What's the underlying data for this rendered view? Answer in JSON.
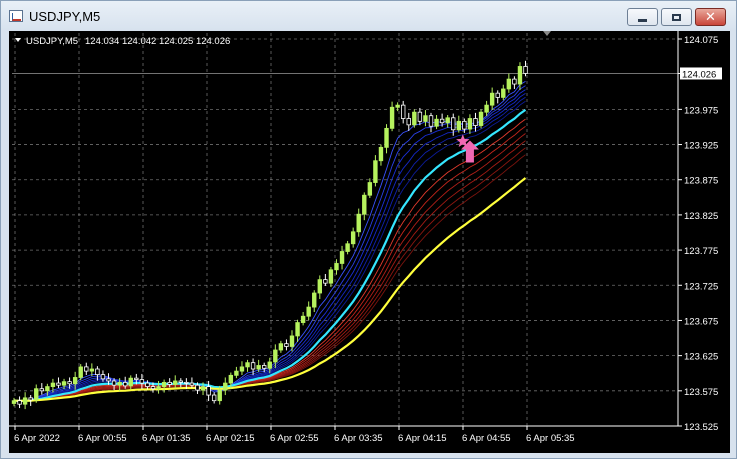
{
  "window": {
    "title": "USDJPY,M5",
    "minimize_label": "Minimize",
    "maximize_label": "Maximize",
    "close_label": "Close"
  },
  "chart_header": {
    "symbol": "USDJPY,M5",
    "ohlc": "124.034 124.042 124.025 124.026"
  },
  "colors": {
    "background": "#000000",
    "grid": "#c8c8c8",
    "bull_candle": "#b6f25e",
    "bear_candle": "#ffffff",
    "ema_fast_group": "#1a2fd6",
    "ema_cyan": "#35e6ff",
    "ema_slow_group": "#c4261c",
    "ema_yellow": "#ffff3c",
    "signal_marker": "#f068b4"
  },
  "chart_data": {
    "type": "candlestick",
    "symbol": "USDJPY",
    "timeframe": "M5",
    "current_price": "124.026",
    "y_ticks": [
      "124.075",
      "124.026",
      "123.975",
      "123.925",
      "123.875",
      "123.825",
      "123.775",
      "123.725",
      "123.675",
      "123.625",
      "123.575",
      "123.525"
    ],
    "y_tick_values": [
      124.075,
      124.026,
      123.975,
      123.925,
      123.875,
      123.825,
      123.775,
      123.725,
      123.675,
      123.625,
      123.575,
      123.525
    ],
    "ylim": [
      123.525,
      124.075
    ],
    "x_ticks": [
      "6 Apr 2022",
      "6 Apr 00:55",
      "6 Apr 01:35",
      "6 Apr 02:15",
      "6 Apr 02:55",
      "6 Apr 03:35",
      "6 Apr 04:15",
      "6 Apr 04:55",
      "6 Apr 05:35"
    ],
    "grid": true,
    "closes": [
      123.561,
      123.556,
      123.565,
      123.562,
      123.578,
      123.575,
      123.581,
      123.586,
      123.583,
      123.588,
      123.585,
      123.594,
      123.609,
      123.603,
      123.606,
      123.598,
      123.592,
      123.589,
      123.583,
      123.587,
      123.582,
      123.593,
      123.591,
      123.586,
      123.581,
      123.578,
      123.581,
      123.587,
      123.584,
      123.589,
      123.587,
      123.586,
      123.583,
      123.576,
      123.581,
      123.569,
      123.561,
      123.576,
      123.586,
      123.597,
      123.603,
      123.609,
      123.615,
      123.606,
      123.611,
      123.607,
      123.616,
      123.633,
      123.642,
      123.638,
      123.653,
      123.672,
      123.681,
      123.694,
      123.714,
      123.733,
      123.728,
      123.747,
      123.756,
      123.773,
      123.784,
      123.801,
      123.826,
      123.853,
      123.871,
      123.902,
      123.921,
      123.948,
      123.978,
      123.981,
      123.962,
      123.953,
      123.971,
      123.958,
      123.966,
      123.951,
      123.961,
      123.956,
      123.963,
      123.946,
      123.958,
      123.947,
      123.962,
      123.952,
      123.971,
      123.981,
      123.998,
      123.992,
      124.004,
      124.018,
      124.011,
      124.036,
      124.026
    ],
    "markers": [
      {
        "type": "star",
        "name": "signal-star",
        "at_close_index": 80
      },
      {
        "type": "up-arrow",
        "name": "buy-arrow",
        "at_close_index": 82
      }
    ]
  }
}
